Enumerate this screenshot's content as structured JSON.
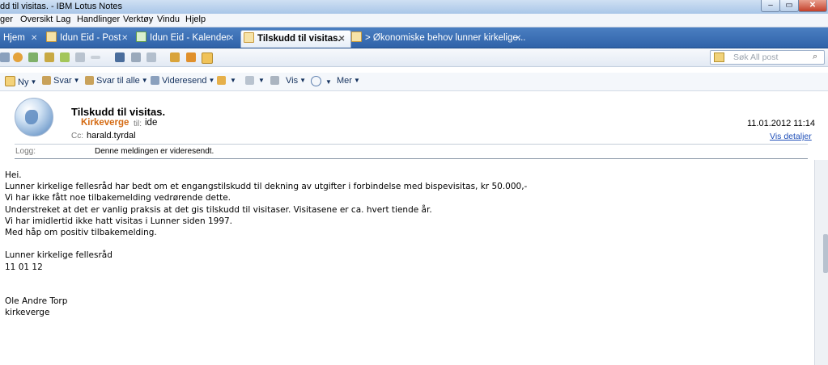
{
  "window": {
    "title": "dd til visitas. - IBM Lotus Notes",
    "minimize": "‒",
    "maximize": "▭",
    "close": "✕"
  },
  "menu": [
    "ger",
    "Oversikt",
    "Lag",
    "Handlinger",
    "Verktøy",
    "Vindu",
    "Hjelp"
  ],
  "tabs": [
    {
      "label": "Hjem",
      "close": "✕"
    },
    {
      "label": "Idun Eid - Post",
      "close": "✕"
    },
    {
      "label": "Idun Eid - Kalender",
      "close": "✕"
    },
    {
      "label": "Tilskudd til visitas.",
      "close": "✕"
    },
    {
      "label": "> Økonomiske behov lunner kirkelige...",
      "close": "✕"
    }
  ],
  "search": {
    "placeholder": "Søk All post"
  },
  "actions": {
    "new": "Ny",
    "reply": "Svar",
    "reply_all": "Svar til alle",
    "forward": "Videresend",
    "view": "Vis",
    "more": "Mer"
  },
  "email": {
    "subject": "Tilskudd til visitas.",
    "from": "Kirkeverge",
    "to_label": "til:",
    "to": "ide",
    "cc_label": "Cc:",
    "cc": "harald.tyrdal",
    "date": "11.01.2012 11:14",
    "details_link": "Vis detaljer",
    "log_label": "Logg:",
    "log_text": "Denne meldingen er videresendt.",
    "body": [
      "Hei.",
      "Lunner kirkelige fellesråd har bedt om et engangstilskudd til dekning av utgifter i forbindelse med bispevisitas, kr 50.000,-",
      "Vi har ikke fått noe tilbakemelding vedrørende dette.",
      "Understreket at det er vanlig praksis at det gis tilskudd til visitaser. Visitasene er ca. hvert tiende år.",
      "Vi har imidlertid ikke hatt visitas i Lunner siden 1997.",
      "Med håp om positiv tilbakemelding.",
      "",
      "Lunner kirkelige fellesråd",
      "11 01 12",
      "",
      "",
      "Ole Andre Torp",
      "kirkeverge"
    ]
  },
  "colors": {
    "accent": "#2f62a8",
    "sender": "#d46a12",
    "link": "#1f4fb8"
  }
}
